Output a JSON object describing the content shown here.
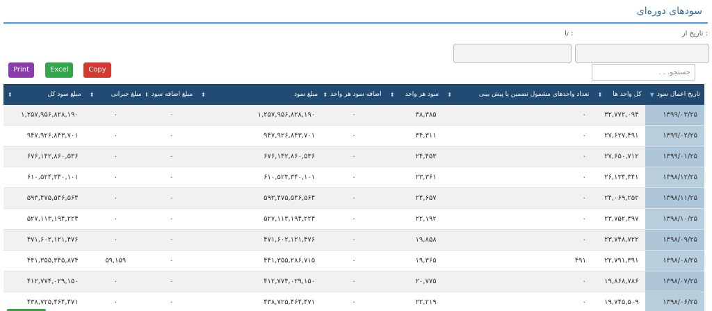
{
  "page": {
    "title": "سودهای دوره‌ای"
  },
  "filters": {
    "from_label": "تاریخ از :",
    "to_label": "تا :",
    "from_value": "",
    "to_value": ""
  },
  "toolbar": {
    "print_label": "Print",
    "excel_label": "Excel",
    "copy_label": "Copy"
  },
  "search": {
    "placeholder": "جستجو. . ."
  },
  "table": {
    "columns": [
      "تاریخ اعمال سود",
      "کل واحد ها",
      "تعداد واحدهای مشمول تضمین یا پیش بینی",
      "سود هر واحد",
      "اضافه سود هر واحد",
      "مبلغ سود",
      "مبلغ اضافه سود",
      "مبلغ جبرانی",
      "مبلغ سود کل"
    ],
    "rows": [
      [
        "۱۳۹۹/۰۳/۲۵",
        "۳۲,۷۷۲,۰۹۴",
        "۰",
        "۳۸,۳۸۵",
        "۰",
        "۱,۲۵۷,۹۵۶,۸۲۸,۱۹۰",
        "۰",
        "۰",
        "۱,۲۵۷,۹۵۶,۸۲۸,۱۹۰"
      ],
      [
        "۱۳۹۹/۰۲/۲۵",
        "۲۷,۶۲۷,۴۹۱",
        "۰",
        "۳۴,۳۱۱",
        "۰",
        "۹۴۷,۹۲۶,۸۴۳,۷۰۱",
        "۰",
        "۰",
        "۹۴۷,۹۲۶,۸۴۳,۷۰۱"
      ],
      [
        "۱۳۹۹/۰۱/۲۵",
        "۲۷,۶۵۰,۷۱۲",
        "۰",
        "۲۴,۴۵۳",
        "۰",
        "۶۷۶,۱۴۲,۸۶۰,۵۳۶",
        "۰",
        "۰",
        "۶۷۶,۱۴۲,۸۶۰,۵۳۶"
      ],
      [
        "۱۳۹۸/۱۲/۲۵",
        "۲۶,۱۳۴,۳۴۱",
        "۰",
        "۲۳,۳۶۱",
        "۰",
        "۶۱۰,۵۲۴,۳۴۰,۱۰۱",
        "۰",
        "۰",
        "۶۱۰,۵۲۴,۳۴۰,۱۰۱"
      ],
      [
        "۱۳۹۸/۱۱/۲۵",
        "۲۴,۰۶۹,۲۵۲",
        "۰",
        "۲۴,۶۵۷",
        "۰",
        "۵۹۳,۴۷۵,۵۴۶,۵۶۴",
        "۰",
        "۰",
        "۵۹۳,۴۷۵,۵۴۶,۵۶۴"
      ],
      [
        "۱۳۹۸/۱۰/۲۵",
        "۲۳,۷۵۲,۳۹۷",
        "۰",
        "۲۲,۱۹۲",
        "۰",
        "۵۲۷,۱۱۳,۱۹۴,۲۲۴",
        "۰",
        "۰",
        "۵۲۷,۱۱۳,۱۹۴,۲۲۴"
      ],
      [
        "۱۳۹۸/۰۹/۲۵",
        "۲۳,۷۴۸,۷۲۲",
        "۰",
        "۱۹,۸۵۸",
        "۰",
        "۴۷۱,۶۰۲,۱۲۱,۴۷۶",
        "۰",
        "۰",
        "۴۷۱,۶۰۲,۱۲۱,۴۷۶"
      ],
      [
        "۱۳۹۸/۰۸/۲۵",
        "۲۲,۷۹۱,۳۹۱",
        "۴۹۱",
        "۱۹,۳۶۵",
        "۰",
        "۴۴۱,۳۵۵,۲۸۶,۷۱۵",
        "۰",
        "۵۹,۱۵۹",
        "۴۴۱,۳۵۵,۳۴۵,۸۷۴"
      ],
      [
        "۱۳۹۸/۰۷/۲۵",
        "۱۹,۸۶۸,۷۸۶",
        "۰",
        "۲۰,۷۷۵",
        "۰",
        "۴۱۲,۷۷۴,۰۲۹,۱۵۰",
        "۰",
        "۰",
        "۴۱۲,۷۷۴,۰۲۹,۱۵۰"
      ],
      [
        "۱۳۹۸/۰۶/۲۵",
        "۱۹,۷۴۵,۵۰۹",
        "۰",
        "۲۲,۲۱۹",
        "۰",
        "۴۳۸,۷۲۵,۴۶۴,۴۷۱",
        "۰",
        "۰",
        "۴۳۸,۷۲۵,۴۶۴,۴۷۱"
      ]
    ]
  },
  "icons": {
    "sort": "sort-icon",
    "sort_desc": "sort-desc-icon"
  }
}
